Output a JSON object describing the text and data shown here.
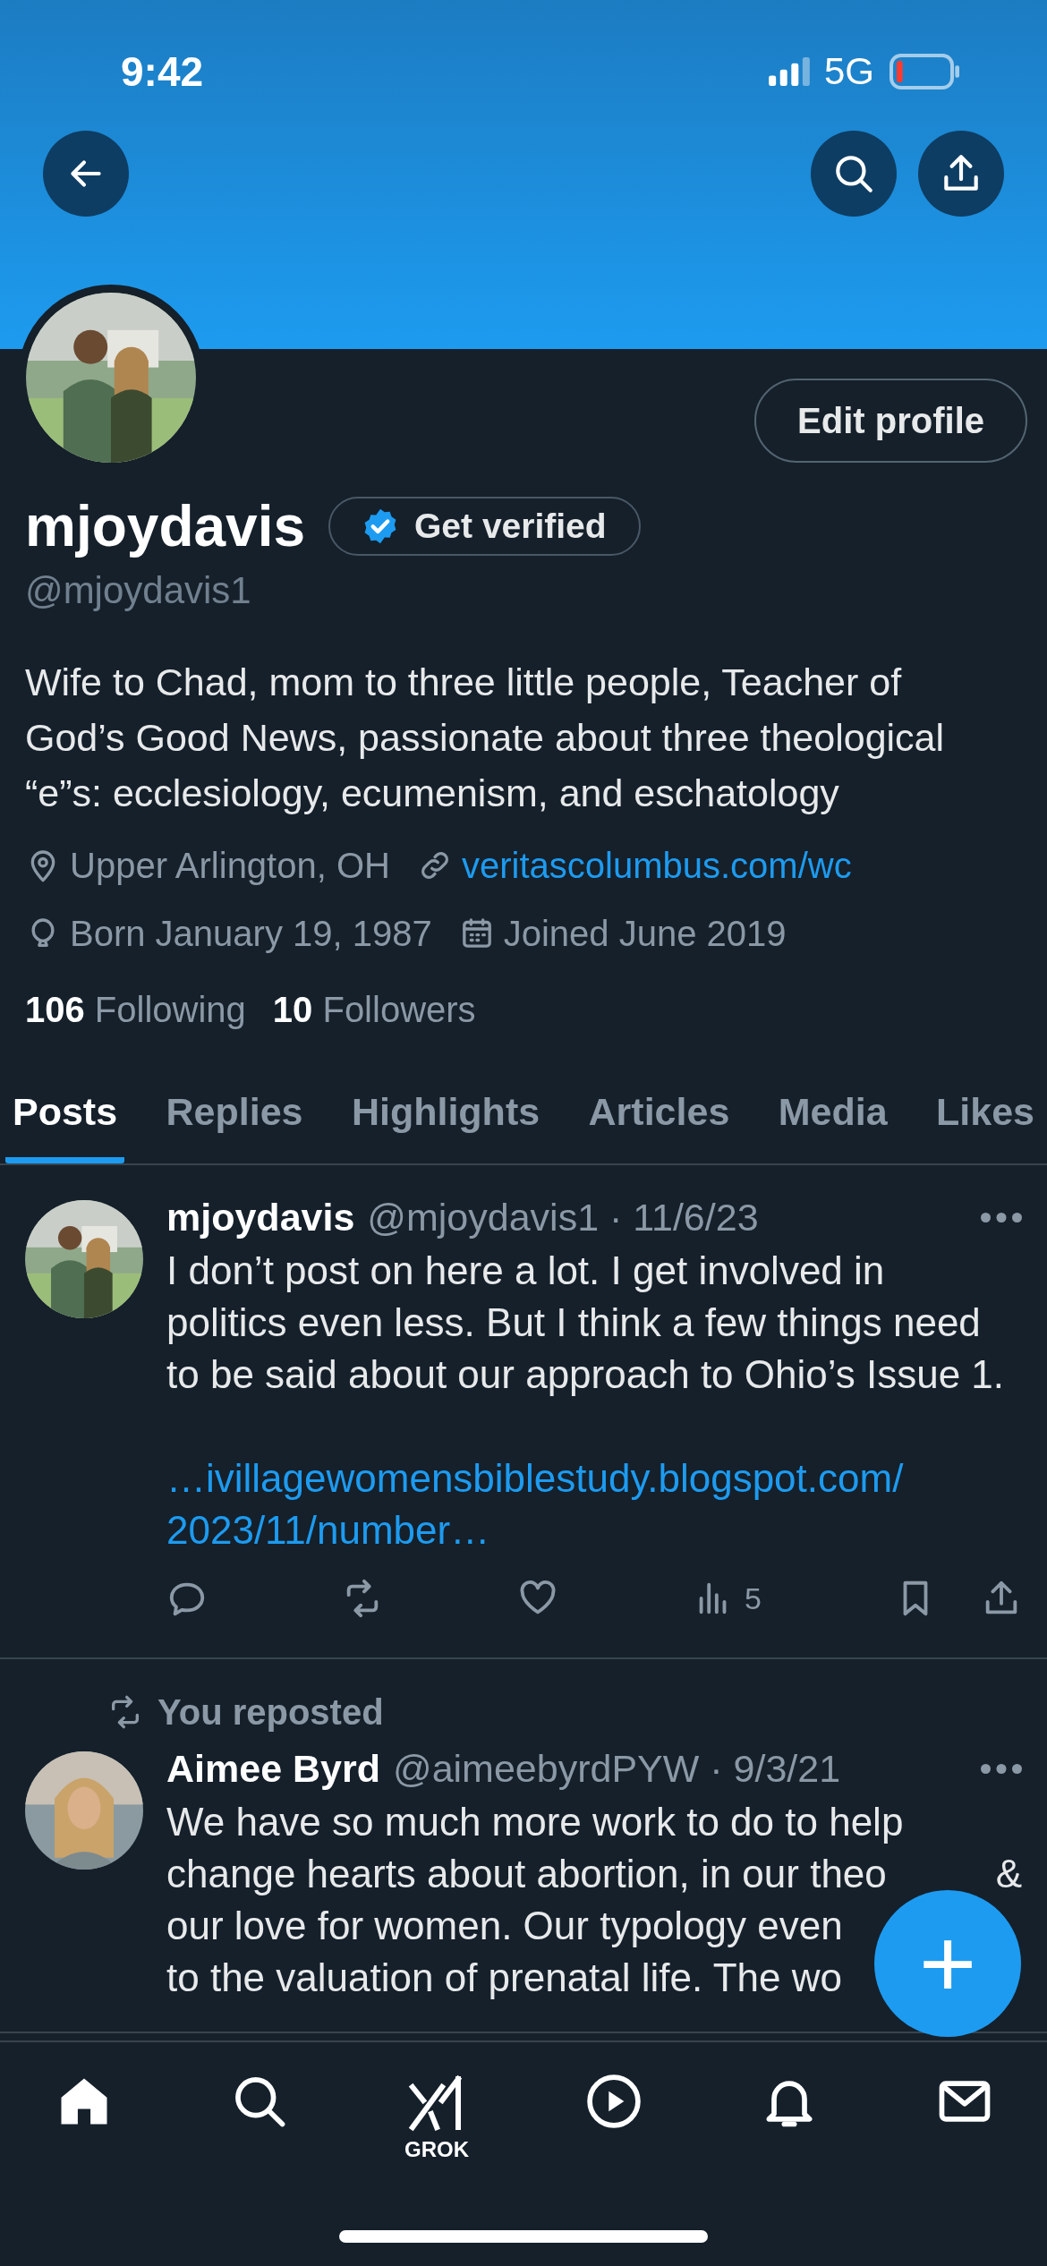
{
  "status_bar": {
    "time": "9:42",
    "network": "5G"
  },
  "header": {
    "left": [
      {
        "kind": "back"
      }
    ],
    "right": [
      {
        "kind": "search"
      },
      {
        "kind": "share"
      }
    ]
  },
  "profile": {
    "edit_label": "Edit profile",
    "name": "mjoydavis",
    "verify_label": "Get verified",
    "handle": "@mjoydavis1",
    "bio": "Wife to Chad, mom to three little people, Teacher of God’s Good News, passionate about three theological “e”s: ecclesiology, ecumenism, and eschatology",
    "detail_rows": [
      [
        {
          "kind": "location",
          "text": "Upper Arlington, OH"
        },
        {
          "kind": "link",
          "text": "veritascolumbus.com/wc"
        }
      ],
      [
        {
          "kind": "birthday",
          "text": "Born January 19, 1987"
        },
        {
          "kind": "joined",
          "text": "Joined June 2019"
        }
      ]
    ],
    "stats": [
      {
        "count": "106",
        "label": "Following"
      },
      {
        "count": "10",
        "label": "Followers"
      }
    ]
  },
  "tabs": [
    {
      "label": "Posts",
      "selected": true
    },
    {
      "label": "Replies",
      "selected": false
    },
    {
      "label": "Highlights",
      "selected": false
    },
    {
      "label": "Articles",
      "selected": false
    },
    {
      "label": "Media",
      "selected": false
    },
    {
      "label": "Likes",
      "selected": false
    }
  ],
  "posts": [
    {
      "name": "mjoydavis",
      "meta": "@mjoydavis1 · 11/6/23",
      "lines": [
        {
          "text": "I don’t post on here a lot. I get involved in"
        },
        {
          "text": "politics even less. But I think a few things need"
        },
        {
          "text": "to be said about our approach to Ohio’s Issue 1."
        }
      ],
      "link_lines": [
        "…ivillagewomensbiblestudy.blogspot.com/",
        "2023/11/number…"
      ],
      "views": "5"
    },
    {
      "repost_label": "You reposted",
      "name": "Aimee Byrd",
      "meta": "@aimeebyrdPYW · 9/3/21",
      "lines": [
        {
          "text": "We have so much more work to do to help"
        },
        {
          "text": "change hearts about abortion, in our theo",
          "tail": "&"
        },
        {
          "text": "our love for women. Our typology even"
        },
        {
          "text": "to the valuation of prenatal life. The wo"
        }
      ]
    }
  ],
  "compose": {
    "label": "+"
  },
  "nav": [
    {
      "kind": "home",
      "selected": true
    },
    {
      "kind": "search",
      "selected": false
    },
    {
      "kind": "grok",
      "label": "GROK",
      "selected": false
    },
    {
      "kind": "video",
      "selected": false
    },
    {
      "kind": "notifications",
      "selected": false
    },
    {
      "kind": "messages",
      "selected": false
    }
  ]
}
